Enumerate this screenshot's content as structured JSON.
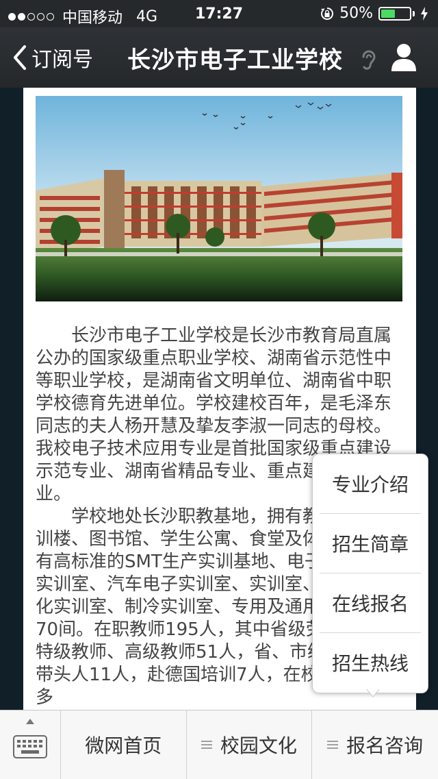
{
  "status_bar": {
    "carrier": "中国移动",
    "network": "4G",
    "time": "17:27",
    "battery_percent": "50%",
    "battery_level": 0.5,
    "signal_bars_filled": 2,
    "signal_bars_total": 5
  },
  "nav": {
    "back_label": "订阅号",
    "title": "长沙市电子工业学校"
  },
  "article": {
    "paragraphs": [
      "长沙市电子工业学校是长沙市教育局直属公办的国家级重点职业学校、湖南省示范性中等职业学校，是湖南省文明单位、湖南省中职学校德育先进单位。学校建校百年，是毛泽东同志的夫人杨开慧及挚友李淑一同志的母校。我校电子技术应用专业是首批国家级重点建设示范专业、湖南省精品专业、重点建设示范专业。",
      "学校地处长沙职教基地，拥有教学楼、实训楼、图书馆、学生公寓、食堂及体育馆，建有高标准的SMT生产实训基地、电子电工综合实训室、汽车电子实训室、实训室、机电一体化实训室、制冷实训室、专用及通用机房等近70间。在职教师195人，其中省级劳模3人，特级教师、高级教师51人，省、市级学科专业带头人11人，赴德国培训7人，在校学生3000多"
    ]
  },
  "popup_menu": {
    "items": [
      "专业介绍",
      "招生简章",
      "在线报名",
      "招生热线"
    ]
  },
  "tab_bar": {
    "tabs": [
      "微网首页",
      "校园文化",
      "报名咨询"
    ]
  },
  "colors": {
    "nav_bg": "#2a2d30",
    "battery_green": "#4cd964",
    "page_bg": "#111f28"
  }
}
